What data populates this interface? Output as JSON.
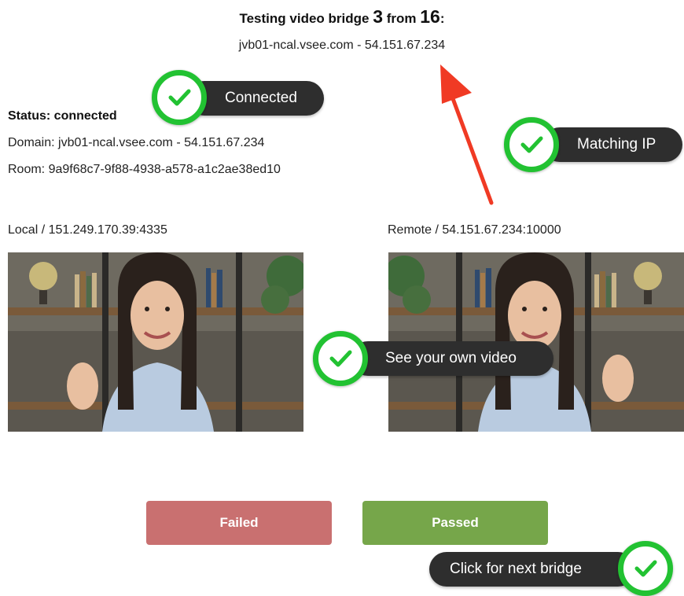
{
  "header": {
    "title_prefix": "Testing video bridge",
    "bridge_number": "3",
    "title_mid": "from",
    "bridge_total": "16",
    "title_suffix": ":",
    "host": "jvb01-ncal.vsee.com - 54.151.67.234"
  },
  "status": {
    "status_text": "Status: connected",
    "domain_text": "Domain: jvb01-ncal.vsee.com - 54.151.67.234",
    "room_text": "Room: 9a9f68c7-9f88-4938-a578-a1c2ae38ed10"
  },
  "videos": {
    "local_label": "Local / 151.249.170.39:4335",
    "remote_label": "Remote / 54.151.67.234:10000"
  },
  "buttons": {
    "failed_label": "Failed",
    "passed_label": "Passed"
  },
  "callouts": {
    "connected": "Connected",
    "matching_ip": "Matching IP",
    "see_video": "See your own video",
    "next_bridge": "Click for next bridge"
  },
  "colors": {
    "failed": "#c97070",
    "passed": "#76a64a",
    "check_green": "#22c232",
    "pill_dark": "#2e2e2e",
    "arrow_red": "#f03a24"
  },
  "icons": {
    "check": "check-circle-icon",
    "arrow": "red-arrow-annotation"
  }
}
